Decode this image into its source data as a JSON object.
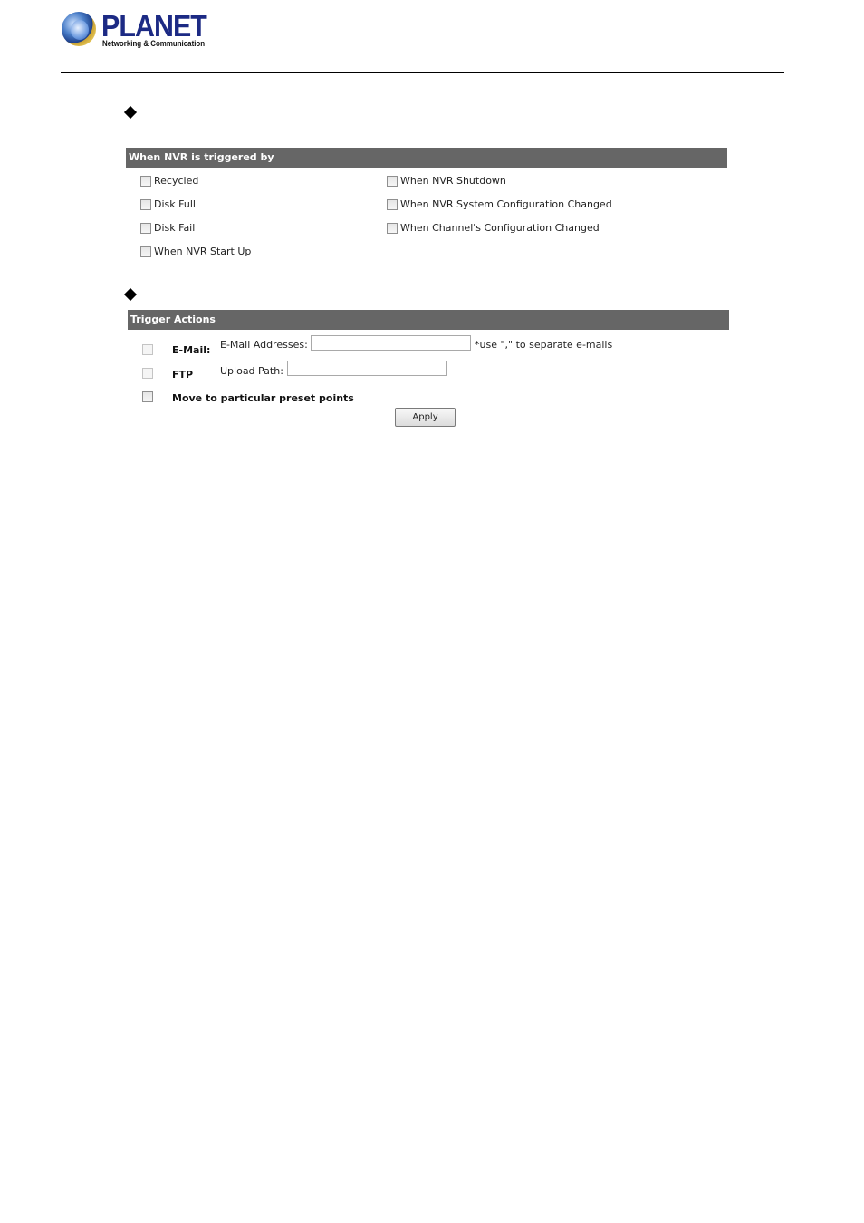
{
  "brand": {
    "name": "PLANET",
    "tagline": "Networking & Communication"
  },
  "trigger_section": {
    "header": "When NVR is triggered by",
    "left_options": [
      {
        "label": "Recycled",
        "checked": false
      },
      {
        "label": "Disk Full",
        "checked": false
      },
      {
        "label": "Disk Fail",
        "checked": false
      },
      {
        "label": "When NVR Start Up",
        "checked": false
      }
    ],
    "right_options": [
      {
        "label": "When NVR Shutdown",
        "checked": false
      },
      {
        "label": "When NVR System Configuration Changed",
        "checked": false
      },
      {
        "label": "When Channel's Configuration Changed",
        "checked": false
      }
    ]
  },
  "actions_section": {
    "header": "Trigger Actions",
    "email": {
      "checked": false,
      "label": "E-Mail:",
      "field_label": "E-Mail Addresses:",
      "value": "",
      "hint": "*use \",\" to separate e-mails"
    },
    "ftp": {
      "checked": false,
      "label": "FTP",
      "field_label": "Upload Path:",
      "value": ""
    },
    "preset": {
      "checked": false,
      "label": "Move to particular preset points"
    },
    "apply_label": "Apply"
  },
  "colors": {
    "header_bar": "#666666",
    "header_text": "#ffffff",
    "brand_blue": "#1c2a84"
  }
}
